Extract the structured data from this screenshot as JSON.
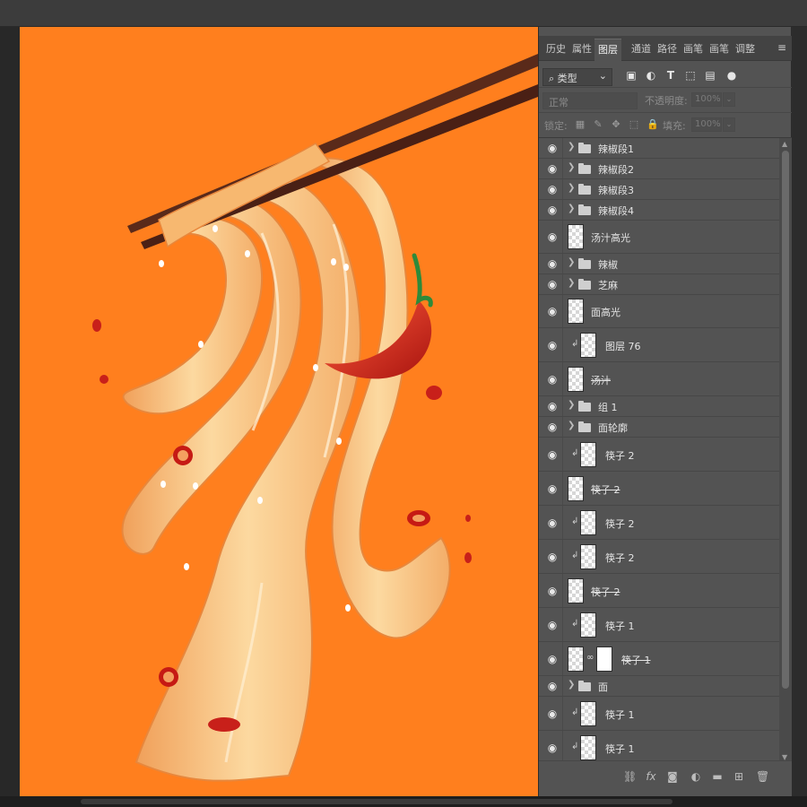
{
  "panel": {
    "tabs": [
      "历史",
      "属性",
      "图层",
      "通道",
      "路径",
      "画笔",
      "画笔",
      "调整"
    ],
    "active_tab": "图层",
    "collapse_icons": [
      "«",
      "×"
    ],
    "menu_icon": "≡",
    "filter": {
      "kind_label": "类型",
      "search_icon": "⌕",
      "dropdown_icon": "⌄",
      "icons": [
        "image-filter-icon",
        "adjustment-filter-icon",
        "type-filter-icon",
        "shape-filter-icon",
        "smart-object-filter-icon",
        "toggle-filter-icon"
      ]
    },
    "blend": {
      "mode": "正常",
      "opacity_label": "不透明度:",
      "opacity_value": "100%"
    },
    "lock": {
      "label": "锁定:",
      "fill_label": "填充:",
      "fill_value": "100%"
    }
  },
  "layers": [
    {
      "name": "辣椒段1",
      "type": "group"
    },
    {
      "name": "辣椒段2",
      "type": "group"
    },
    {
      "name": "辣椒段3",
      "type": "group"
    },
    {
      "name": "辣椒段4",
      "type": "group"
    },
    {
      "name": "汤汁高光",
      "type": "layer"
    },
    {
      "name": "辣椒",
      "type": "group"
    },
    {
      "name": "芝麻",
      "type": "group"
    },
    {
      "name": "面高光",
      "type": "layer"
    },
    {
      "name": "图层 76",
      "type": "clip"
    },
    {
      "name": "汤汁",
      "type": "layer"
    },
    {
      "name": "组 1",
      "type": "group"
    },
    {
      "name": "面轮廓",
      "type": "group"
    },
    {
      "name": "筷子 2",
      "type": "clip"
    },
    {
      "name": "筷子 2",
      "type": "layer"
    },
    {
      "name": "筷子 2",
      "type": "clip"
    },
    {
      "name": "筷子 2",
      "type": "clip"
    },
    {
      "name": "筷子 2",
      "type": "layer"
    },
    {
      "name": "筷子 1",
      "type": "clip"
    },
    {
      "name": "筷子 1",
      "type": "masked"
    },
    {
      "name": "面",
      "type": "group"
    },
    {
      "name": "筷子 1",
      "type": "clip"
    },
    {
      "name": "筷子 1",
      "type": "clip"
    }
  ],
  "bottom_icons": [
    "link-icon",
    "fx-icon",
    "mask-icon",
    "adjustment-icon",
    "folder-icon",
    "new-layer-icon",
    "trash-icon"
  ],
  "colors": {
    "canvas": "#ff7f1e",
    "panel": "#535353",
    "noodle": "#f8c27c",
    "chili": "#d3221c",
    "chopstick": "#5a2a1a"
  }
}
